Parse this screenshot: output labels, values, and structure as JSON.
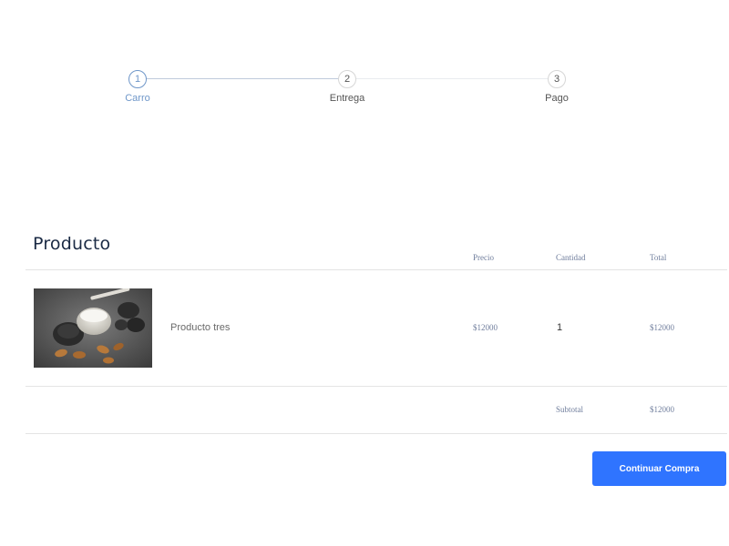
{
  "stepper": {
    "steps": [
      {
        "number": "1",
        "label": "Carro",
        "active": true
      },
      {
        "number": "2",
        "label": "Entrega",
        "active": false
      },
      {
        "number": "3",
        "label": "Pago",
        "active": false
      }
    ]
  },
  "cart": {
    "title": "Producto",
    "columns": {
      "price": "Precio",
      "quantity": "Cantidad",
      "total": "Total"
    },
    "items": [
      {
        "name": "Producto tres",
        "price": "$12000",
        "quantity": "1",
        "total": "$12000"
      }
    ],
    "subtotal_label": "Subtotal",
    "subtotal_value": "$12000"
  },
  "actions": {
    "continue_label": "Continuar Compra"
  },
  "colors": {
    "accent": "#2f74ff",
    "active_step": "#6f97c9",
    "title": "#1a2a44",
    "muted_serif": "#6f7d9c"
  }
}
